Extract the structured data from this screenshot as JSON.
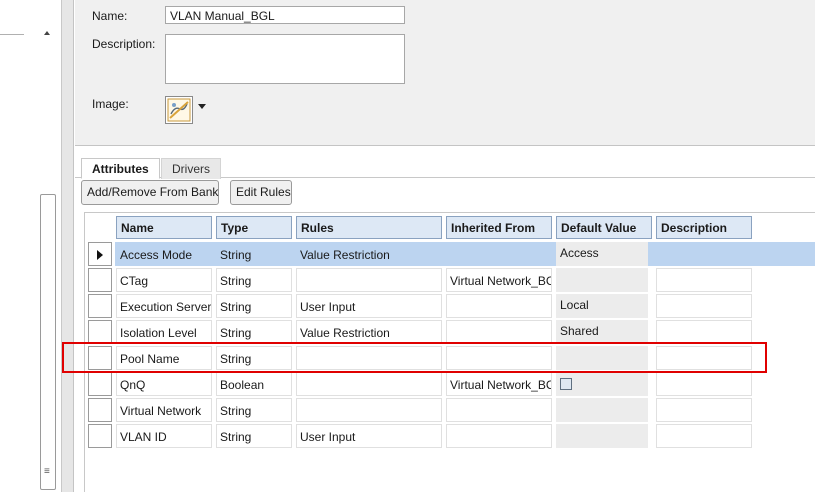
{
  "header": {
    "name_label": "Name:",
    "name_value": "VLAN Manual_BGL",
    "description_label": "Description:",
    "description_value": "",
    "image_label": "Image:",
    "image_icon": "network-image-icon"
  },
  "tabs": [
    {
      "label": "Attributes",
      "active": true
    },
    {
      "label": "Drivers",
      "active": false
    }
  ],
  "toolbar": {
    "add_remove_label": "Add/Remove From Bank",
    "edit_rules_label": "Edit Rules"
  },
  "grid": {
    "columns": [
      "Name",
      "Type",
      "Rules",
      "Inherited From",
      "Default Value",
      "Description"
    ],
    "rows": [
      {
        "name": "Access Mode",
        "type": "String",
        "rules": "Value Restriction",
        "inherited": "",
        "default": "Access",
        "description": "",
        "selected": true
      },
      {
        "name": "CTag",
        "type": "String",
        "rules": "",
        "inherited": "Virtual Network_BC",
        "default": "",
        "description": ""
      },
      {
        "name": "Execution Server",
        "type": "String",
        "rules": "User Input",
        "inherited": "",
        "default": "Local",
        "description": ""
      },
      {
        "name": "Isolation Level",
        "type": "String",
        "rules": "Value Restriction",
        "inherited": "",
        "default": "Shared",
        "description": ""
      },
      {
        "name": "Pool Name",
        "type": "String",
        "rules": "",
        "inherited": "",
        "default": "",
        "description": "",
        "highlighted": true
      },
      {
        "name": "QnQ",
        "type": "Boolean",
        "rules": "",
        "inherited": "Virtual Network_BC",
        "default": "",
        "default_checkbox": true,
        "description": ""
      },
      {
        "name": "Virtual Network",
        "type": "String",
        "rules": "",
        "inherited": "",
        "default": "",
        "description": ""
      },
      {
        "name": "VLAN ID",
        "type": "String",
        "rules": "User Input",
        "inherited": "",
        "default": "",
        "description": ""
      }
    ]
  },
  "colors": {
    "selected_row": "#bcd4f0",
    "header_cell": "#dde8f5",
    "highlight_box": "#e00000"
  }
}
